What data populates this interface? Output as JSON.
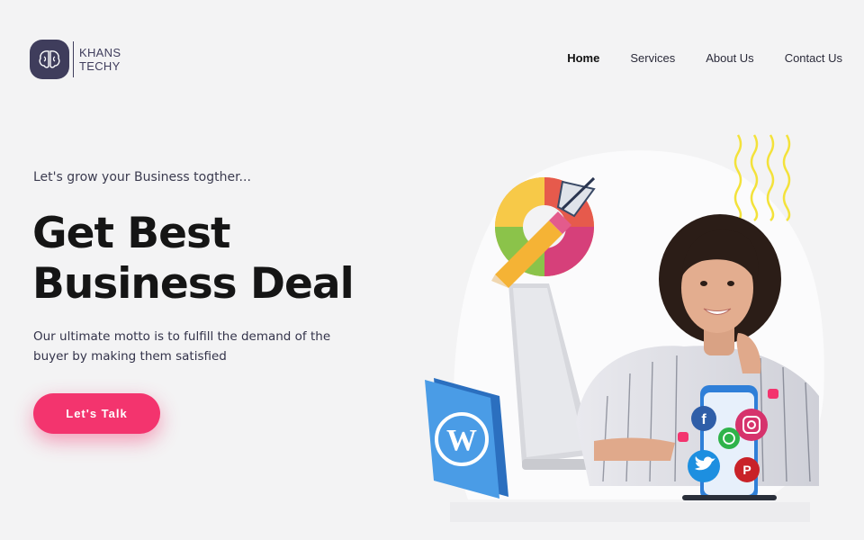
{
  "brand": {
    "line1": "KHANS",
    "line2": "TECHY"
  },
  "nav": {
    "items": [
      {
        "label": "Home",
        "active": true
      },
      {
        "label": "Services",
        "active": false
      },
      {
        "label": "About Us",
        "active": false
      },
      {
        "label": "Contact Us",
        "active": false
      }
    ]
  },
  "hero": {
    "tagline": "Let's grow your Business togther...",
    "headline_line1": "Get Best",
    "headline_line2": "Business Deal",
    "motto": "Our ultimate motto is to fulfill the demand of the buyer by making them satisfied",
    "cta_label": "Let's Talk"
  },
  "colors": {
    "accent": "#f3346e",
    "brand": "#3f3d5c",
    "background": "#f3f3f4",
    "wordpress": "#3b8fd9"
  },
  "icons": {
    "logo": "brain-icon",
    "wordpress": "wordpress-icon",
    "facebook": "facebook-icon",
    "instagram": "instagram-icon",
    "whatsapp": "whatsapp-icon",
    "twitter": "twitter-icon",
    "pinterest": "pinterest-icon",
    "design": "pen-nib-icon"
  }
}
